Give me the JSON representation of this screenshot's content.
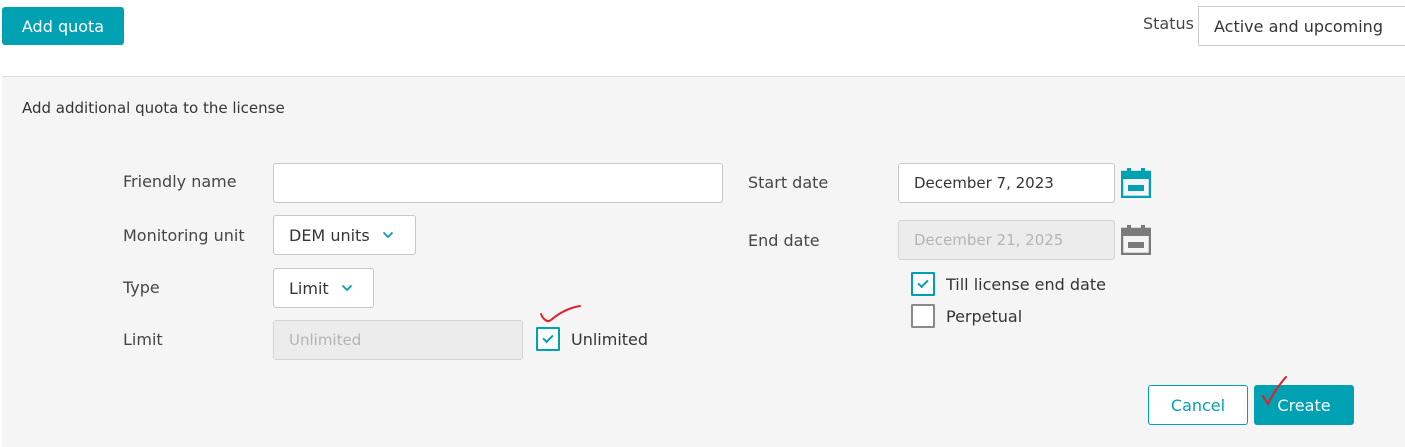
{
  "toolbar": {
    "add_quota_label": "Add quota",
    "status_label": "Status",
    "status_value": "Active and upcoming"
  },
  "panel": {
    "title": "Add additional quota to the license"
  },
  "form": {
    "friendly_name": {
      "label": "Friendly name",
      "value": ""
    },
    "monitoring_unit": {
      "label": "Monitoring unit",
      "value": "DEM units"
    },
    "type": {
      "label": "Type",
      "value": "Limit"
    },
    "limit": {
      "label": "Limit",
      "placeholder": "Unlimited",
      "unlimited_label": "Unlimited",
      "unlimited_checked": true
    },
    "start_date": {
      "label": "Start date",
      "value": "December 7, 2023"
    },
    "end_date": {
      "label": "End date",
      "value": "December 21, 2025"
    },
    "till_license_end": {
      "label": "Till license end date",
      "checked": true
    },
    "perpetual": {
      "label": "Perpetual",
      "checked": false
    }
  },
  "actions": {
    "cancel_label": "Cancel",
    "create_label": "Create"
  },
  "colors": {
    "accent": "#00a1b2",
    "panel_bg": "#f5f5f5",
    "annotation_red": "#e0202a"
  },
  "icons": [
    "calendar-icon",
    "chevron-down-icon",
    "checkmark-icon"
  ]
}
